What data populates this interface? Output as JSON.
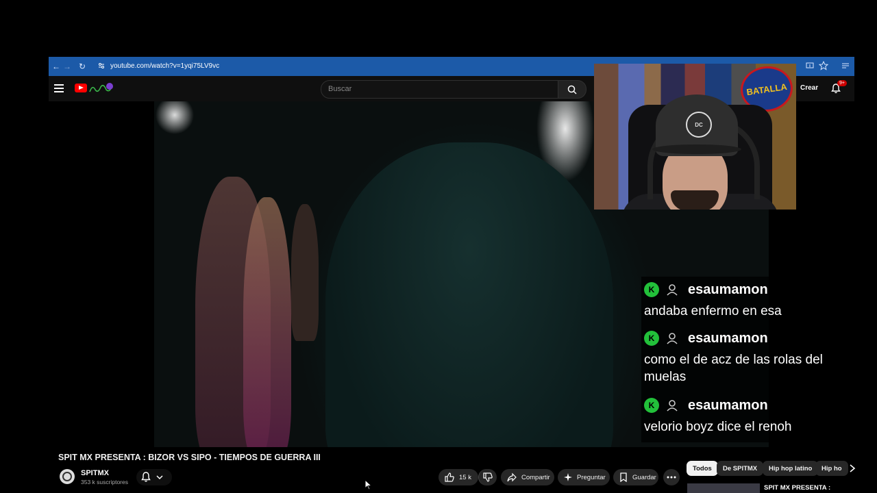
{
  "browser": {
    "url": "youtube.com/watch?v=1yqi75LV9vc"
  },
  "youtube": {
    "search_placeholder": "Buscar",
    "create_label": "Crear",
    "notifications_badge": "9+"
  },
  "webcam": {
    "sign_text": "BATALLA",
    "cap_text": "DC"
  },
  "chat": {
    "messages": [
      {
        "user": "esaumamon",
        "text": "andaba enfermo en esa"
      },
      {
        "user": "esaumamon",
        "text": "como el de acz de las rolas del muelas"
      },
      {
        "user": "esaumamon",
        "text": "velorio boyz dice el renoh"
      }
    ]
  },
  "video": {
    "title": "SPIT MX PRESENTA : BIZOR VS SIPO - TIEMPOS DE GUERRA III",
    "channel": "SPITMX",
    "subscribers": "353 k suscriptores",
    "likes": "15 k",
    "share_label": "Compartir",
    "ask_label": "Preguntar",
    "save_label": "Guardar"
  },
  "chips": [
    "Todos",
    "De SPITMX",
    "Hip hop latino",
    "Hip ho"
  ],
  "recommendation": {
    "title": "SPIT MX PRESENTA :"
  }
}
